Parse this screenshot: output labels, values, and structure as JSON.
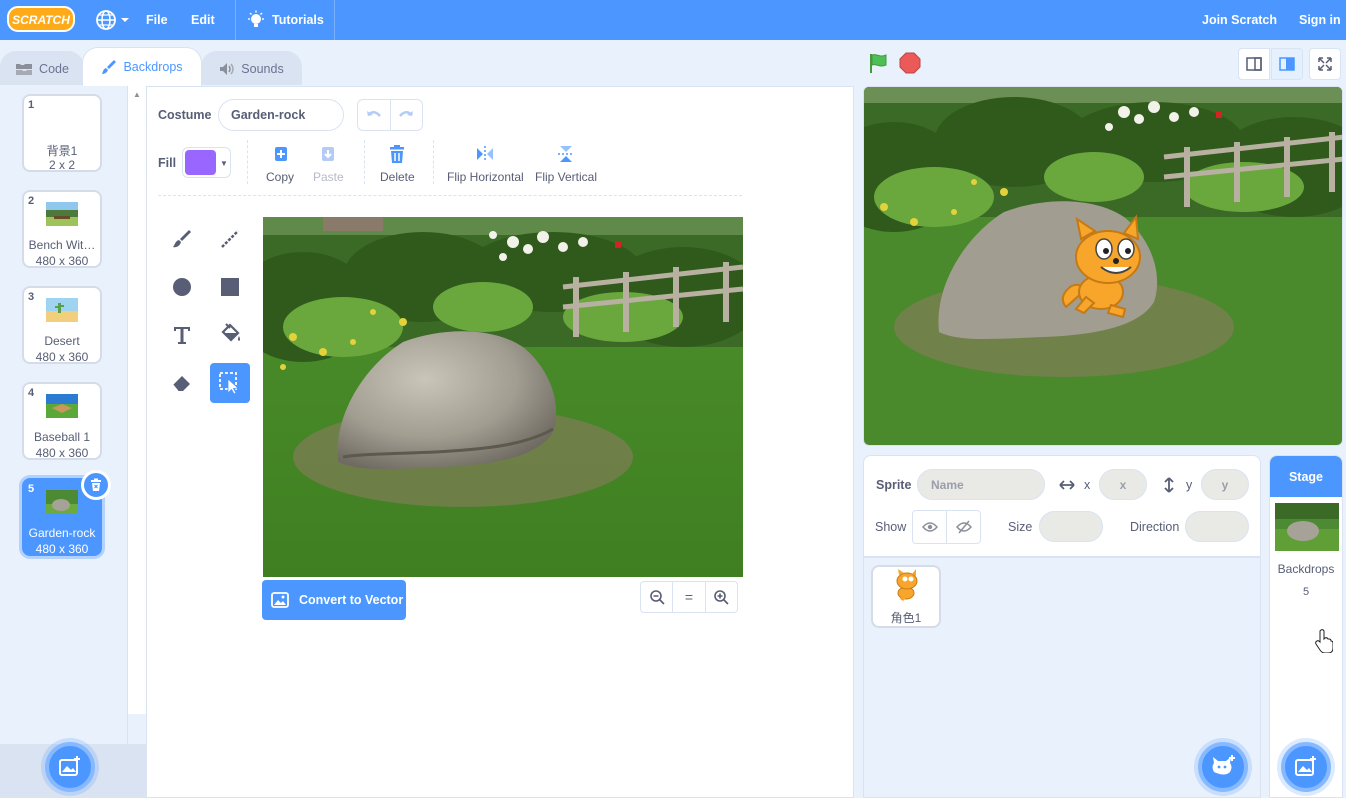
{
  "menubar": {
    "logo_text": "SCRATCH",
    "file": "File",
    "edit": "Edit",
    "tutorials": "Tutorials",
    "join": "Join Scratch",
    "signin": "Sign in"
  },
  "tabs": {
    "code": "Code",
    "backdrops": "Backdrops",
    "sounds": "Sounds"
  },
  "backdrops": [
    {
      "num": "1",
      "name": "背景1",
      "size": "2 x 2"
    },
    {
      "num": "2",
      "name": "Bench Wit…",
      "size": "480 x 360"
    },
    {
      "num": "3",
      "name": "Desert",
      "size": "480 x 360"
    },
    {
      "num": "4",
      "name": "Baseball 1",
      "size": "480 x 360"
    },
    {
      "num": "5",
      "name": "Garden-rock",
      "size": "480 x 360"
    }
  ],
  "editor": {
    "costume_label": "Costume",
    "costume_name": "Garden-rock",
    "fill_label": "Fill",
    "fill_color": "#9966ff",
    "copy": "Copy",
    "paste": "Paste",
    "delete": "Delete",
    "flip_h": "Flip Horizontal",
    "flip_v": "Flip Vertical",
    "convert": "Convert to Vector",
    "zoom_reset": "="
  },
  "sprite_info": {
    "sprite_label": "Sprite",
    "name_placeholder": "Name",
    "x_label": "x",
    "x_placeholder": "x",
    "y_label": "y",
    "y_placeholder": "y",
    "show_label": "Show",
    "size_label": "Size",
    "direction_label": "Direction"
  },
  "sprites": [
    {
      "name": "角色1"
    }
  ],
  "stage_pane": {
    "header": "Stage",
    "backdrops_label": "Backdrops",
    "backdrops_count": "5"
  },
  "colors": {
    "accent": "#4c97ff",
    "fill": "#9966ff",
    "flag": "#4cbf56",
    "stop": "#ec5959"
  }
}
